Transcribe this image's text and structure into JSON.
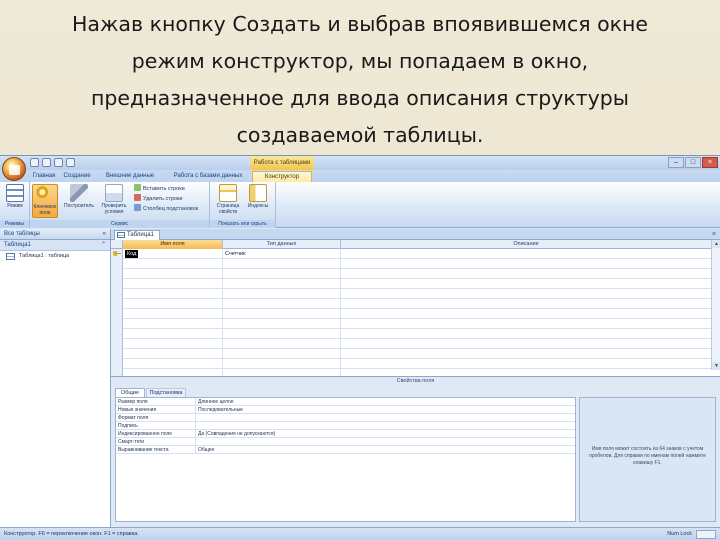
{
  "slide": {
    "line1": "Нажав кнопку Создать и выбрав впоявившемся окне",
    "line2": "режим конструктор, мы попадаем в окно,",
    "line3": "предназначенное для ввода описания структуры",
    "line4": "создаваемой таблицы."
  },
  "window": {
    "contextual_title": "Работа с таблицами",
    "controls": {
      "minimize": "–",
      "maximize": "□",
      "close": "×"
    }
  },
  "ribbon": {
    "tabs": [
      {
        "label": "Главная"
      },
      {
        "label": "Создание"
      },
      {
        "label": "Внешние данные"
      },
      {
        "label": "Работа с базами данных"
      },
      {
        "label": "Конструктор"
      }
    ],
    "groups": {
      "views": {
        "label": "Режимы",
        "view_button": "Режим"
      },
      "tools": {
        "label": "Сервис",
        "key_button": "Ключевое поле",
        "builder_button": "Построитель",
        "check_button": "Проверить условия",
        "insert_rows": "Вставить строки",
        "delete_rows": "Удалить строки",
        "lookup_column": "Столбец подстановок"
      },
      "show_hide": {
        "label": "Показать или скрыть",
        "property_sheet": "Страница свойств",
        "indexes": "Индексы"
      }
    }
  },
  "nav": {
    "header": "Все таблицы",
    "group": "Таблица1",
    "items": [
      {
        "label": "Таблица1 : таблица"
      }
    ]
  },
  "document": {
    "tab_label": "Таблица1",
    "columns": {
      "field_name": "Имя поля",
      "data_type": "Тип данных",
      "description": "Описание"
    },
    "rows": [
      {
        "field_name": "Код",
        "data_type": "Счетчик",
        "description": ""
      }
    ],
    "empty_rows": 12
  },
  "properties": {
    "title": "Свойства поля",
    "tabs": [
      {
        "label": "Общие"
      },
      {
        "label": "Подстановка"
      }
    ],
    "rows": [
      {
        "name": "Размер поля",
        "value": "Длинное целое"
      },
      {
        "name": "Новые значения",
        "value": "Последовательные"
      },
      {
        "name": "Формат поля",
        "value": ""
      },
      {
        "name": "Подпись",
        "value": ""
      },
      {
        "name": "Индексированное поле",
        "value": "Да (Совпадения не допускаются)"
      },
      {
        "name": "Смарт-теги",
        "value": ""
      },
      {
        "name": "Выравнивание текста",
        "value": "Общее"
      }
    ],
    "help_text": "Имя поля может состоять из 64 знаков с учетом пробелов. Для справки по именам полей нажмите клавишу F1."
  },
  "statusbar": {
    "left": "Конструктор. F6 = переключение окон. F1 = справка.",
    "right": "Num Lock"
  },
  "colors": {
    "accent_orange": "#f5a93c",
    "ribbon_blue": "#c9daf0",
    "text_blue": "#15428b"
  }
}
